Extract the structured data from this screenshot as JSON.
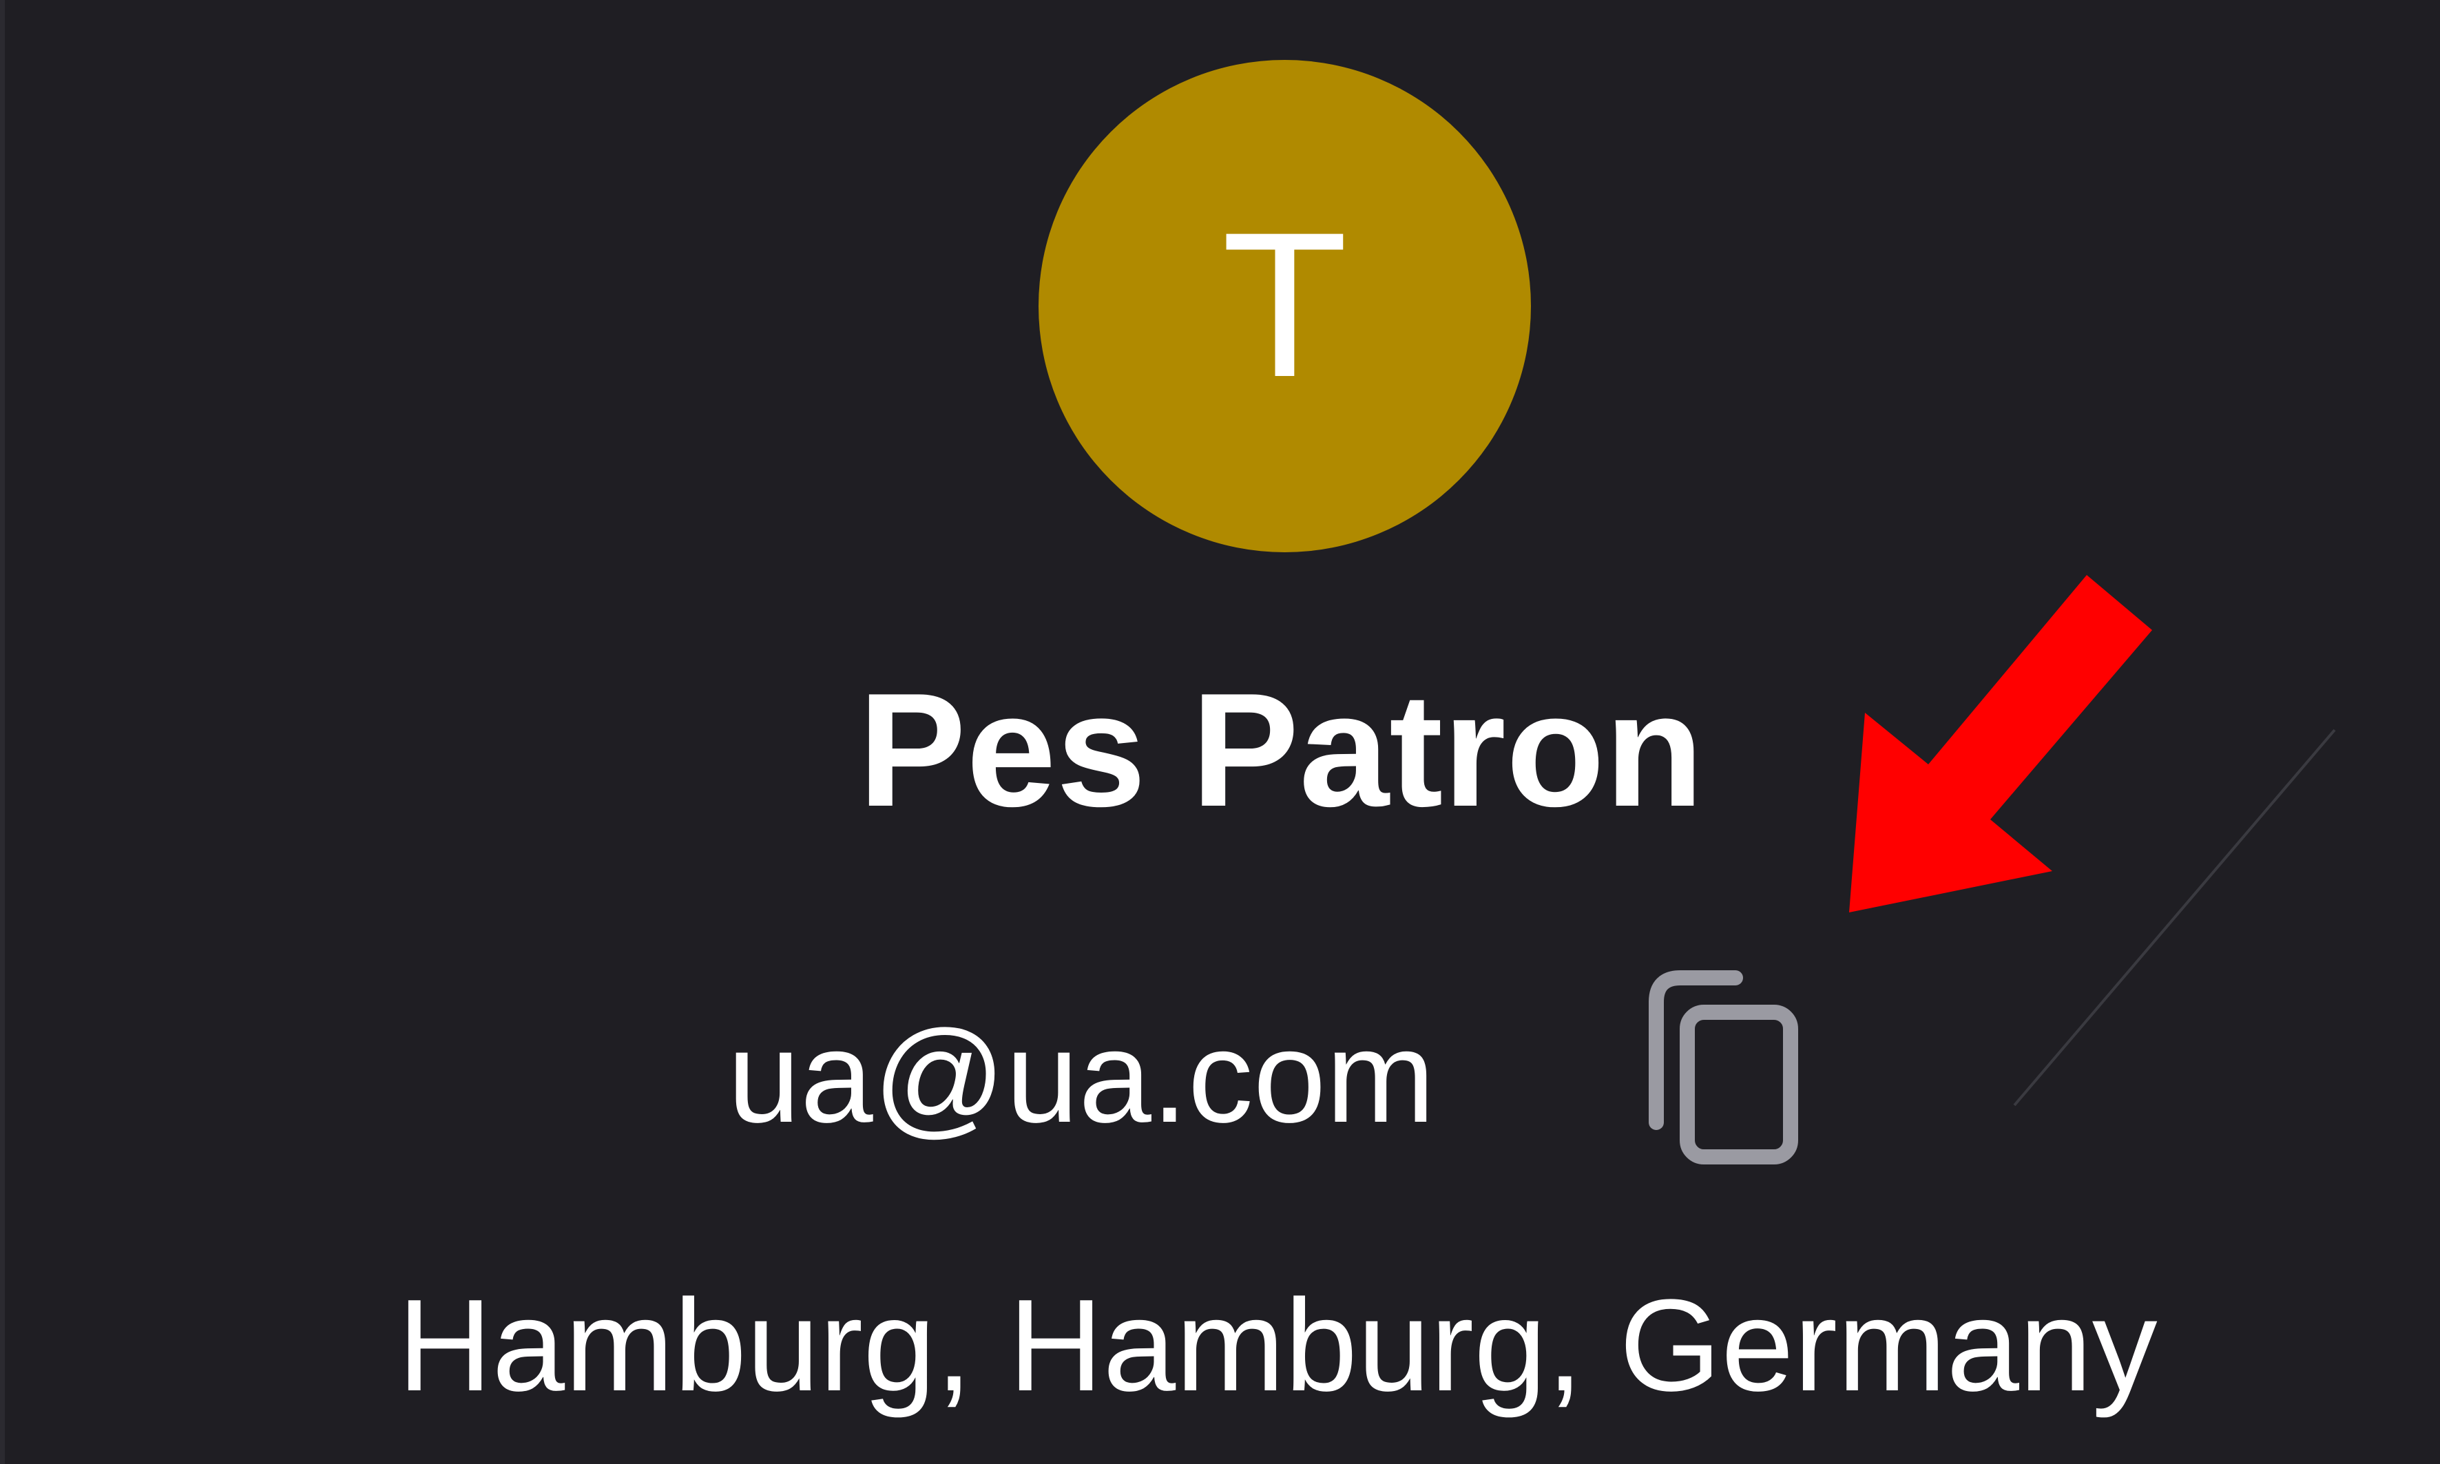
{
  "profile": {
    "avatar_initial": "T",
    "avatar_color": "#b08a00",
    "name": "Pes Patron",
    "email": "ua@ua.com",
    "location": "Hamburg, Hamburg, Germany"
  },
  "actions": {
    "copy_icon": "copy-icon"
  },
  "annotation": {
    "arrow_color": "#ff0000"
  },
  "colors": {
    "background": "#1f1e23",
    "text": "#ffffff",
    "icon": "#9a9aa2"
  }
}
